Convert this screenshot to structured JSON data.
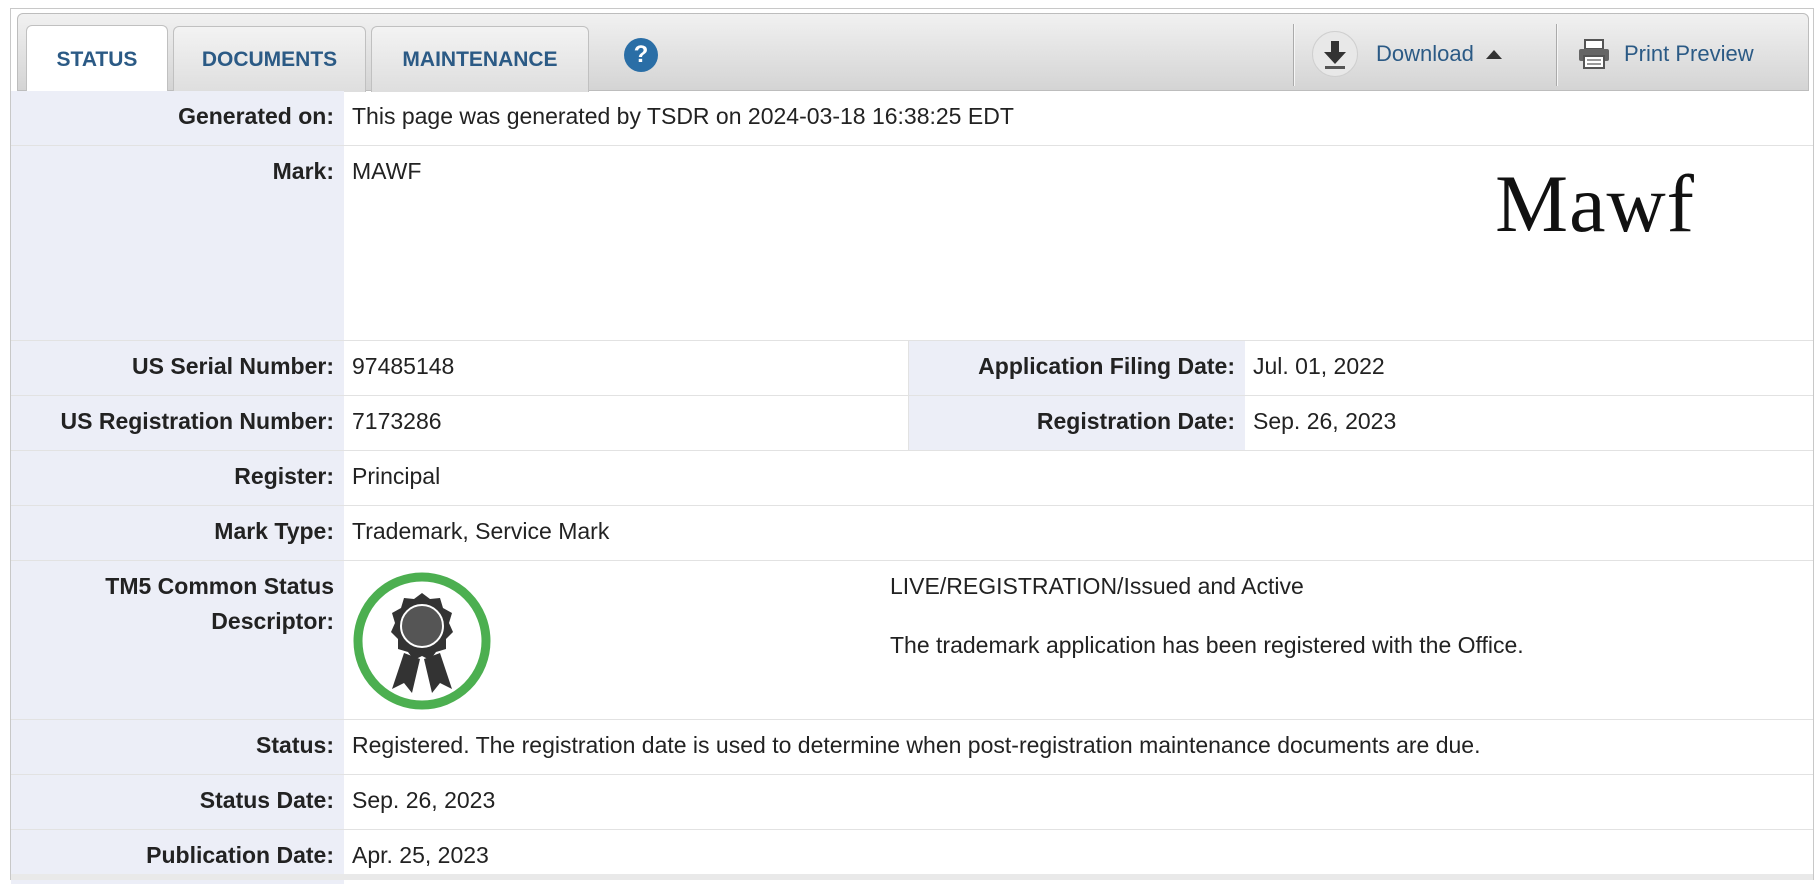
{
  "tabs": [
    {
      "label": "STATUS",
      "active": true
    },
    {
      "label": "DOCUMENTS",
      "active": false
    },
    {
      "label": "MAINTENANCE",
      "active": false
    }
  ],
  "help_icon": "question-circle-icon",
  "toolbar": {
    "download_label": "Download",
    "print_label": "Print Preview"
  },
  "fields": {
    "generated_on": {
      "label": "Generated on:",
      "value": "This page was generated by TSDR on 2024-03-18 16:38:25 EDT"
    },
    "mark": {
      "label": "Mark:",
      "value": "MAWF",
      "image_text": "Mawf"
    },
    "serial_number": {
      "label": "US Serial Number:",
      "value": "97485148"
    },
    "filing_date": {
      "label": "Application Filing Date:",
      "value": "Jul. 01, 2022"
    },
    "registration_number": {
      "label": "US Registration Number:",
      "value": "7173286"
    },
    "registration_date": {
      "label": "Registration Date:",
      "value": "Sep. 26, 2023"
    },
    "register": {
      "label": "Register:",
      "value": "Principal"
    },
    "mark_type": {
      "label": "Mark Type:",
      "value": "Trademark, Service Mark"
    },
    "tm5": {
      "label_line1": "TM5 Common Status",
      "label_line2": "Descriptor:",
      "descriptor": "LIVE/REGISTRATION/Issued and Active",
      "description": "The trademark application has been registered with the Office.",
      "badge_color": "#4caf50"
    },
    "status": {
      "label": "Status:",
      "value": "Registered. The registration date is used to determine when post-registration maintenance documents are due."
    },
    "status_date": {
      "label": "Status Date:",
      "value": "Sep. 26, 2023"
    },
    "publication_date": {
      "label": "Publication Date:",
      "value": "Apr. 25, 2023"
    }
  },
  "colors": {
    "accent": "#2b5a85",
    "label_bg": "#eceef7"
  }
}
